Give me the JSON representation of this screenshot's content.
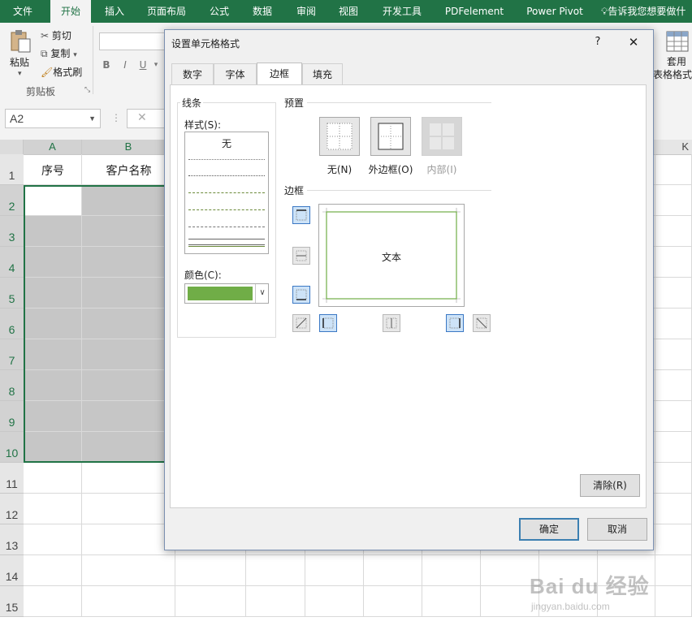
{
  "ribbon": {
    "tabs": [
      "文件",
      "开始",
      "插入",
      "页面布局",
      "公式",
      "数据",
      "审阅",
      "视图",
      "开发工具",
      "PDFelement",
      "Power Pivot",
      "告诉我您想要做什"
    ],
    "active_tab": "开始",
    "clipboard": {
      "paste": "粘贴",
      "cut": "剪切",
      "copy": "复制",
      "format_painter": "格式刷",
      "group": "剪贴板"
    },
    "font_buttons": [
      "B",
      "I",
      "U"
    ],
    "table_format": {
      "line1": "套用",
      "line2": "表格格式"
    }
  },
  "formula_bar": {
    "name_box": "A2",
    "cancel_icon": "✕"
  },
  "sheet": {
    "columns": [
      "A",
      "B",
      "K"
    ],
    "rows": [
      "1",
      "2",
      "3",
      "4",
      "5",
      "6",
      "7",
      "8",
      "9",
      "10",
      "11",
      "12",
      "13",
      "14",
      "15"
    ],
    "header_cells": {
      "A1": "序号",
      "B1": "客户名称"
    }
  },
  "dialog": {
    "title": "设置单元格格式",
    "help": "?",
    "close": "✕",
    "tabs": [
      "数字",
      "字体",
      "边框",
      "填充"
    ],
    "active_tab": "边框",
    "line_group": "线条",
    "style_label": "样式(S):",
    "style_none": "无",
    "color_label": "颜色(C):",
    "selected_color": "#70ad47",
    "preset_group": "预置",
    "presets": [
      {
        "label": "无(N)",
        "enabled": true
      },
      {
        "label": "外边框(O)",
        "enabled": true
      },
      {
        "label": "内部(I)",
        "enabled": false
      }
    ],
    "border_group": "边框",
    "preview_text": "文本",
    "clear_button": "清除(R)",
    "ok_button": "确定",
    "cancel_button": "取消"
  },
  "watermark": {
    "brand": "Bai du 经验",
    "url": "jingyan.baidu.com"
  }
}
